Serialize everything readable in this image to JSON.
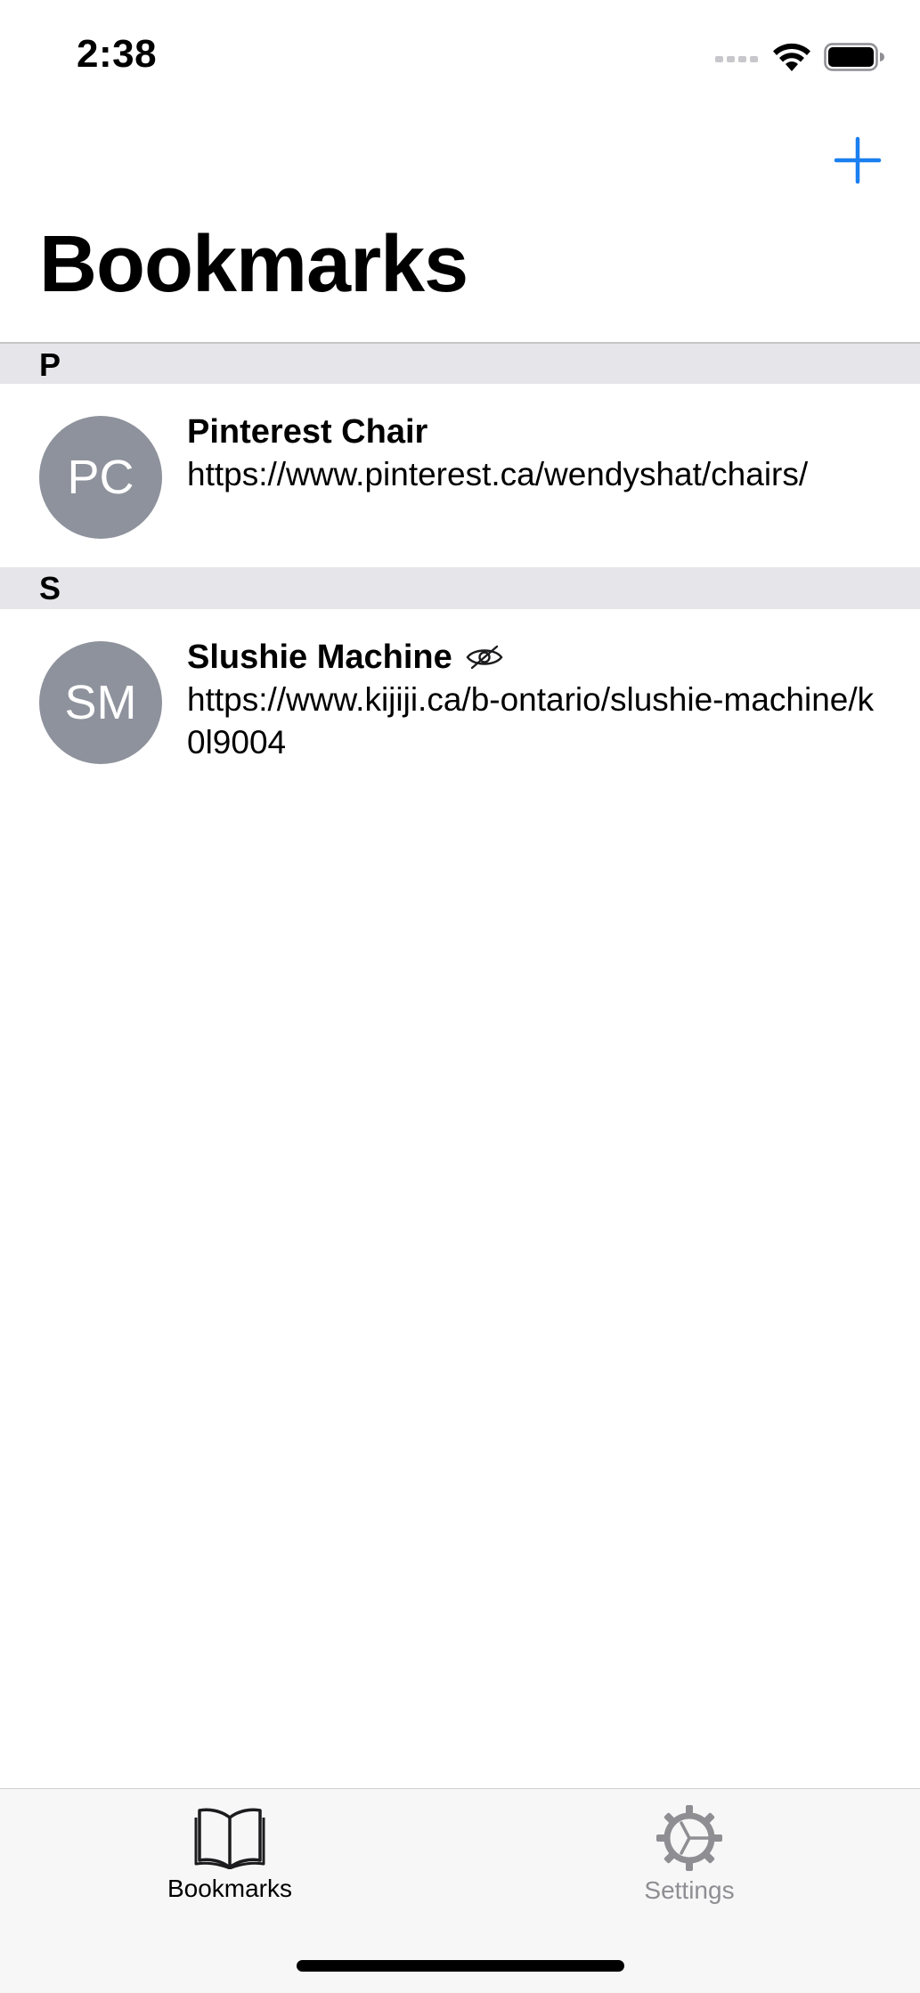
{
  "status_bar": {
    "time": "2:38"
  },
  "nav": {
    "add_icon": "plus-icon",
    "accent_color": "#1a7ff0"
  },
  "page": {
    "title": "Bookmarks"
  },
  "sections": [
    {
      "letter": "P",
      "items": [
        {
          "initials": "PC",
          "title": "Pinterest Chair",
          "url": "https://www.pinterest.ca/wendyshat/chairs/",
          "hidden": false
        }
      ]
    },
    {
      "letter": "S",
      "items": [
        {
          "initials": "SM",
          "title": "Slushie Machine",
          "url": "https://www.kijiji.ca/b-ontario/slushie-machine/k0l9004",
          "hidden": true,
          "hidden_icon": "eye-slash-icon"
        }
      ]
    }
  ],
  "tab_bar": {
    "tabs": [
      {
        "label": "Bookmarks",
        "icon": "book-icon",
        "active": true
      },
      {
        "label": "Settings",
        "icon": "gear-icon",
        "active": false
      }
    ]
  },
  "colors": {
    "avatar": "#8e929c",
    "section_header": "#e5e5ea",
    "inactive_tab": "#8e8e93"
  }
}
